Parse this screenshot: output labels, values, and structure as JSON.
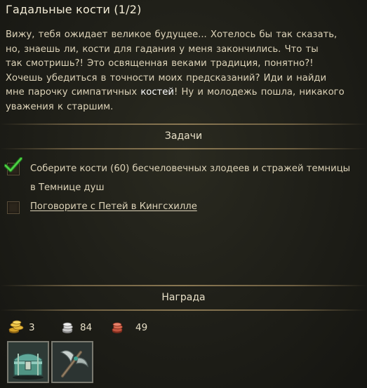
{
  "quest": {
    "title": "Гадальные кости (1/2)",
    "description_lines": [
      "Вижу, тебя ожидает великое будущее... Хотелось бы так сказать,",
      "но, знаешь ли, кости для гадания у меня закончились. Что ты",
      "так смотришь?! Это освященная веками традиция, понятно?!",
      "Хочешь убедиться в точности моих предсказаний? Иди и найди",
      "мне парочку симпатичных ",
      "костей",
      "! Ну и молодежь пошла, никакого",
      "уважения к старшим."
    ]
  },
  "tasks": {
    "header": "Задачи",
    "items": [
      {
        "line1": "Соберите кости (60) бесчеловечных злодеев и стражей темницы",
        "line2": "в Темнице душ",
        "done": true
      },
      {
        "line1": "Поговорите с Петей в Кингсхилле",
        "done": false
      }
    ]
  },
  "reward": {
    "header": "Награда",
    "gold": "3",
    "silver": "84",
    "copper": "49",
    "items": [
      "chest-icon",
      "axe-icon"
    ]
  },
  "colors": {
    "accent_check": "#3fbf3a",
    "gold": "#d9a528",
    "silver": "#c8c8c8",
    "copper": "#c2543e"
  }
}
